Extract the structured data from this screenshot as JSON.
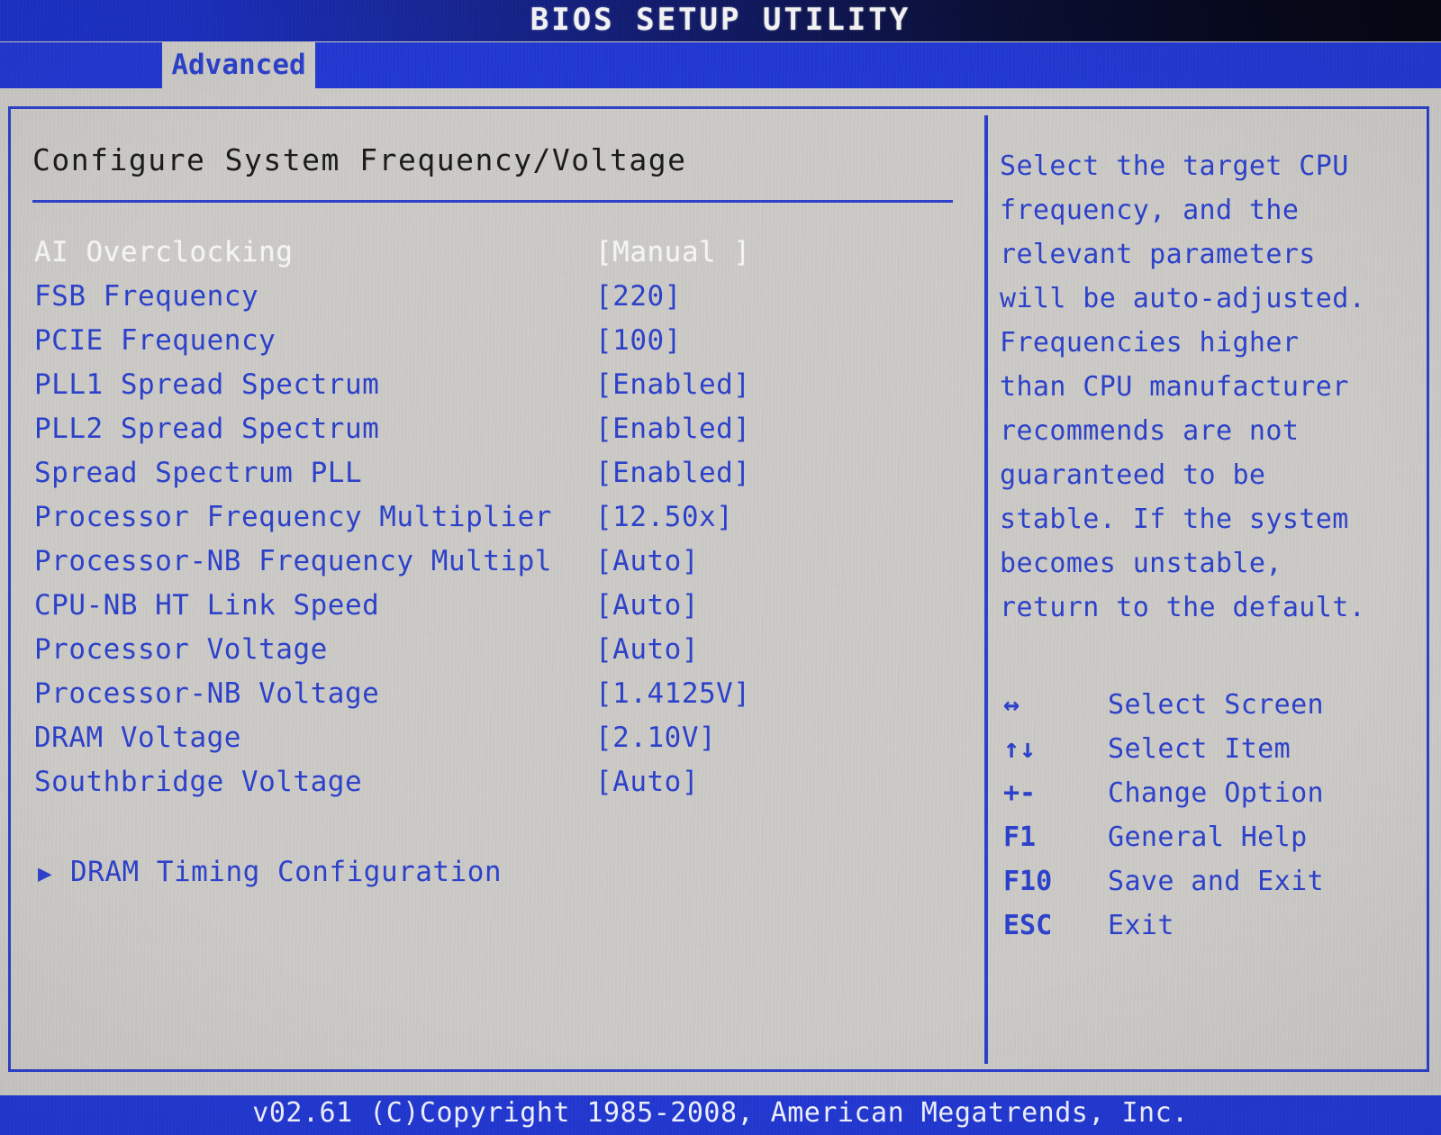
{
  "header": {
    "title": "BIOS SETUP UTILITY",
    "tabs": [
      {
        "label": "Advanced",
        "active": true
      }
    ]
  },
  "main": {
    "section_title": "Configure System Frequency/Voltage",
    "settings": [
      {
        "label": "AI Overclocking",
        "value": "[Manual ]",
        "selected": true
      },
      {
        "label": "FSB Frequency",
        "value": "[220]",
        "selected": false
      },
      {
        "label": "PCIE Frequency",
        "value": "[100]",
        "selected": false
      },
      {
        "label": "PLL1 Spread Spectrum",
        "value": "[Enabled]",
        "selected": false
      },
      {
        "label": "PLL2 Spread Spectrum",
        "value": "[Enabled]",
        "selected": false
      },
      {
        "label": "Spread Spectrum PLL",
        "value": "[Enabled]",
        "selected": false
      },
      {
        "label": "Processor Frequency Multiplier",
        "value": "[12.50x]",
        "selected": false
      },
      {
        "label": "Processor-NB Frequency Multipl",
        "value": "[Auto]",
        "selected": false
      },
      {
        "label": "CPU-NB HT Link Speed",
        "value": "[Auto]",
        "selected": false
      },
      {
        "label": "Processor Voltage",
        "value": "[Auto]",
        "selected": false
      },
      {
        "label": "Processor-NB Voltage",
        "value": "[1.4125V]",
        "selected": false
      },
      {
        "label": "DRAM Voltage",
        "value": "[2.10V]",
        "selected": false
      },
      {
        "label": "Southbridge Voltage",
        "value": "[Auto]",
        "selected": false
      }
    ],
    "submenus": [
      {
        "arrow_icon": "triangle-right-icon",
        "label": "DRAM Timing Configuration"
      }
    ]
  },
  "help": {
    "lines": [
      "Select the target CPU",
      "frequency, and the",
      "relevant parameters",
      "will be auto-adjusted.",
      "Frequencies higher",
      "than CPU manufacturer",
      "recommends are not",
      "guaranteed to be",
      "stable. If the system",
      "becomes unstable,",
      "return to the default."
    ]
  },
  "keys": [
    {
      "key": "↔",
      "desc": "Select Screen"
    },
    {
      "key": "↑↓",
      "desc": "Select Item"
    },
    {
      "key": "+-",
      "desc": "Change Option"
    },
    {
      "key": "F1",
      "desc": "General Help"
    },
    {
      "key": "F10",
      "desc": "Save and Exit"
    },
    {
      "key": "ESC",
      "desc": "Exit"
    }
  ],
  "footer": {
    "text": "v02.61 (C)Copyright 1985-2008, American Megatrends, Inc."
  },
  "colors": {
    "accent_blue": "#2b3fc8",
    "bar_blue": "#2237cf",
    "background_grey": "#c9c7c3",
    "selected_white": "#f4f4f4",
    "title_dark": "#1a1a1a"
  }
}
